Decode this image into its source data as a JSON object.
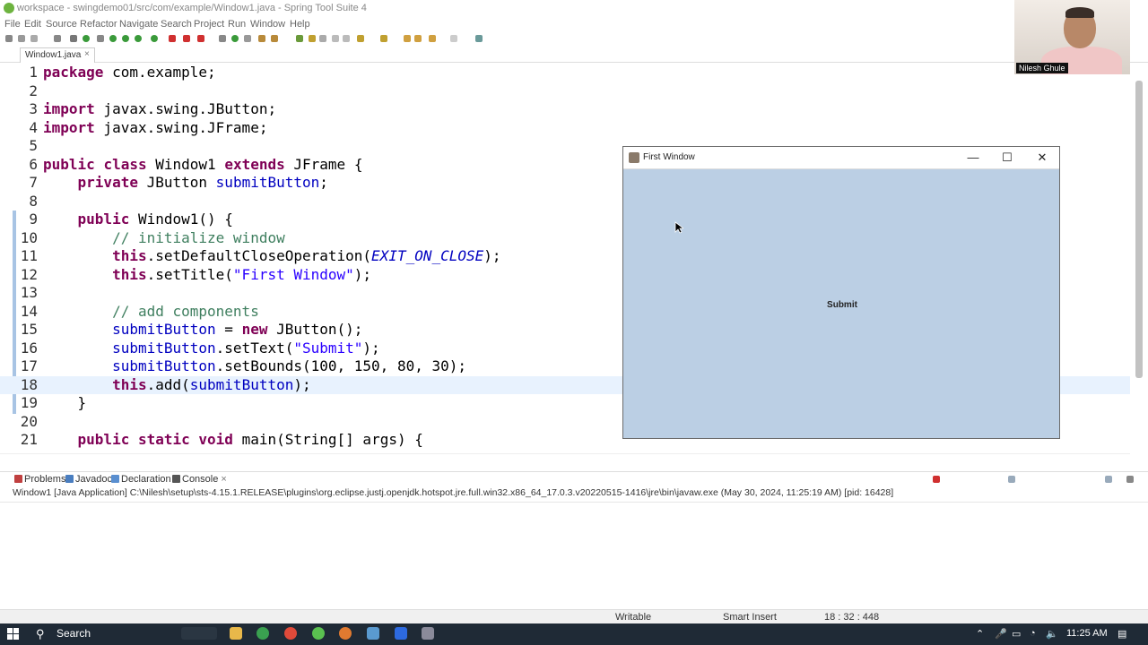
{
  "window": {
    "title": "workspace - swingdemo01/src/com/example/Window1.java - Spring Tool Suite 4"
  },
  "menu": [
    "File",
    "Edit",
    "Source",
    "Refactor",
    "Navigate",
    "Search",
    "Project",
    "Run",
    "Window",
    "Help"
  ],
  "editor": {
    "tab_label": "Window1.java",
    "tab_close": "×",
    "lines": [
      {
        "n": "1",
        "code": "package com.example;"
      },
      {
        "n": "2",
        "code": ""
      },
      {
        "n": "3",
        "code": "import javax.swing.JButton;"
      },
      {
        "n": "4",
        "code": "import javax.swing.JFrame;"
      },
      {
        "n": "5",
        "code": ""
      },
      {
        "n": "6",
        "code": "public class Window1 extends JFrame {"
      },
      {
        "n": "7",
        "code": "    private JButton submitButton;"
      },
      {
        "n": "8",
        "code": ""
      },
      {
        "n": "9",
        "code": "    public Window1() {"
      },
      {
        "n": "10",
        "code": "        // initialize window"
      },
      {
        "n": "11",
        "code": "        this.setDefaultCloseOperation(EXIT_ON_CLOSE);"
      },
      {
        "n": "12",
        "code": "        this.setTitle(\"First Window\");"
      },
      {
        "n": "13",
        "code": ""
      },
      {
        "n": "14",
        "code": "        // add components"
      },
      {
        "n": "15",
        "code": "        submitButton = new JButton();"
      },
      {
        "n": "16",
        "code": "        submitButton.setText(\"Submit\");"
      },
      {
        "n": "17",
        "code": "        submitButton.setBounds(100, 150, 80, 30);"
      },
      {
        "n": "18",
        "code": "        this.add(submitButton);"
      },
      {
        "n": "19",
        "code": "    }"
      },
      {
        "n": "20",
        "code": ""
      },
      {
        "n": "21",
        "code": "    public static void main(String[] args) {"
      }
    ]
  },
  "first_window": {
    "title": "First Window",
    "minimize": "—",
    "maximize": "☐",
    "close": "✕",
    "button_label": "Submit"
  },
  "panel": {
    "tabs": [
      {
        "label": "Problems",
        "color": "#c04040"
      },
      {
        "label": "Javadoc",
        "color": "#4a7ec0"
      },
      {
        "label": "Declaration",
        "color": "#5a8fd0"
      },
      {
        "label": "Console",
        "color": "#333333",
        "close": "×"
      }
    ],
    "console_info": "Window1 [Java Application] C:\\Nilesh\\setup\\sts-4.15.1.RELEASE\\plugins\\org.eclipse.justj.openjdk.hotspot.jre.full.win32.x86_64_17.0.3.v20220515-1416\\jre\\bin\\javaw.exe  (May 30, 2024, 11:25:19 AM) [pid: 16428]"
  },
  "status": {
    "writable": "Writable",
    "insert_mode": "Smart Insert",
    "position": "18 : 32 : 448"
  },
  "taskbar": {
    "search_label": "Search",
    "time": "11:25 AM"
  },
  "webcam": {
    "name": "Nilesh Ghule"
  }
}
